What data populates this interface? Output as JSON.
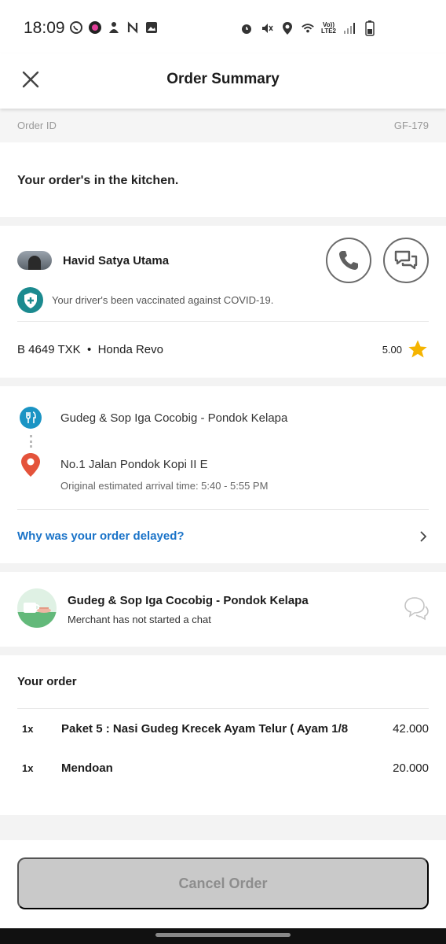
{
  "status_bar": {
    "time": "18:09",
    "lte_top": "Vo))",
    "lte_bottom": "LTE2",
    "left_icons": [
      "whatsapp-icon",
      "app-icon",
      "notification-icon",
      "nfc-icon",
      "gallery-icon"
    ],
    "right_icons": [
      "alarm-icon",
      "mute-icon",
      "location-icon",
      "wifi-icon",
      "signal-icon",
      "battery-icon"
    ]
  },
  "header": {
    "title": "Order Summary",
    "close_icon": "close-icon"
  },
  "order_id": {
    "label": "Order ID",
    "value": "GF-179"
  },
  "status": {
    "message": "Your order's in the kitchen."
  },
  "driver": {
    "name": "Havid Satya Utama",
    "vaccine_note": "Your driver's been vaccinated against COVID-19.",
    "plate": "B 4649 TXK",
    "separator": "•",
    "vehicle": "Honda Revo",
    "rating": "5.00",
    "rating_color": "#f5b400",
    "vaccine_color": "#1b8a8f"
  },
  "route": {
    "restaurant": "Gudeg & Sop Iga Cocobig - Pondok Kelapa",
    "destination": "No.1 Jalan Pondok Kopi II E",
    "eta": "Original estimated arrival time: 5:40 - 5:55 PM",
    "delay_link": "Why was your order delayed?",
    "link_color": "#1a73c8"
  },
  "merchant": {
    "name": "Gudeg & Sop Iga Cocobig - Pondok Kelapa",
    "chat_status": "Merchant has not started a chat"
  },
  "order": {
    "title": "Your order",
    "items": [
      {
        "qty": "1x",
        "name": "Paket 5 : Nasi Gudeg Krecek Ayam Telur ( Ayam 1/8",
        "price": "42.000"
      },
      {
        "qty": "1x",
        "name": "Mendoan",
        "price": "20.000"
      }
    ]
  },
  "actions": {
    "cancel_label": "Cancel Order"
  }
}
